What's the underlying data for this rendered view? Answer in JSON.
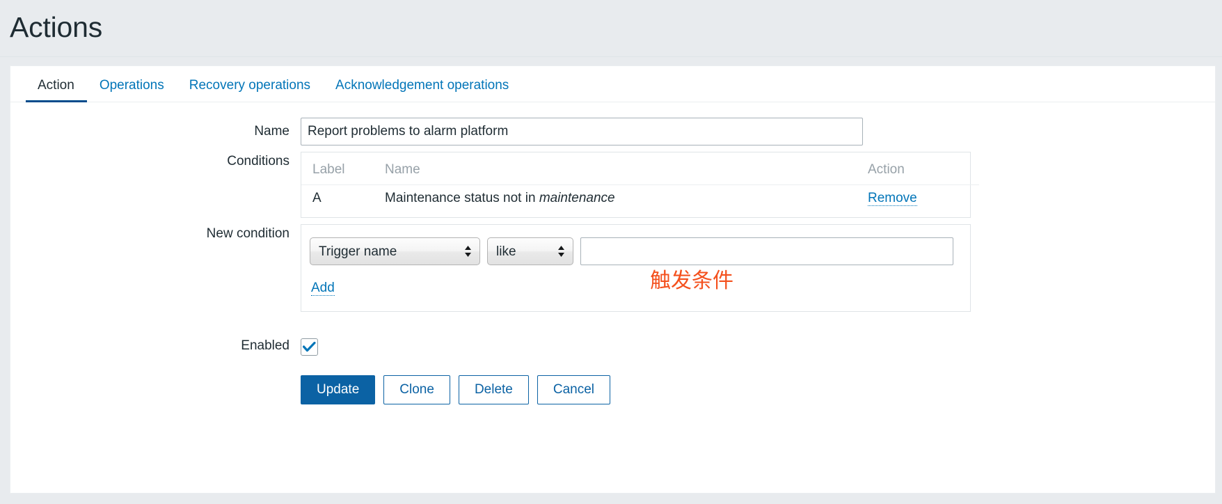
{
  "header": {
    "title": "Actions"
  },
  "tabs": [
    {
      "label": "Action",
      "active": true
    },
    {
      "label": "Operations",
      "active": false
    },
    {
      "label": "Recovery operations",
      "active": false
    },
    {
      "label": "Acknowledgement operations",
      "active": false
    }
  ],
  "form": {
    "name": {
      "label": "Name",
      "value": "Report problems to alarm platform",
      "placeholder": ""
    },
    "conditions": {
      "label": "Conditions",
      "columns": [
        "Label",
        "Name",
        "Action"
      ],
      "rows": [
        {
          "label": "A",
          "name_prefix": "Maintenance status not in ",
          "name_italic": "maintenance",
          "action": "Remove"
        }
      ]
    },
    "new_condition": {
      "label": "New condition",
      "type_select": {
        "value": "Trigger name",
        "options": [
          "Trigger name"
        ]
      },
      "operator_select": {
        "value": "like",
        "options": [
          "like"
        ]
      },
      "value_input": {
        "value": "",
        "placeholder": ""
      },
      "add_label": "Add"
    },
    "enabled": {
      "label": "Enabled",
      "checked": true
    }
  },
  "buttons": {
    "update": "Update",
    "clone": "Clone",
    "delete": "Delete",
    "cancel": "Cancel"
  },
  "annotation": {
    "text": "触发条件",
    "color": "#f4511e"
  },
  "colors": {
    "page_background": "#e8ebee",
    "panel_background": "#ffffff",
    "link": "#0275b8",
    "primary_button": "#0b62a4",
    "active_tab_underline": "#004b8c",
    "muted_text": "#97a1a8"
  }
}
